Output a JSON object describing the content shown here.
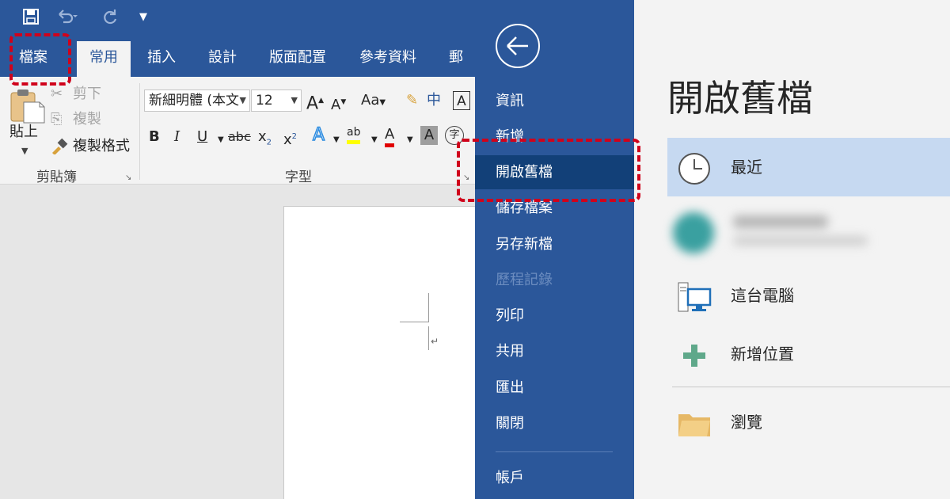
{
  "quick_access": {
    "save_icon": "save-icon",
    "undo_icon": "undo-icon",
    "redo_icon": "redo-icon",
    "customize_icon": "customize-qat-icon"
  },
  "ribbon_tabs": [
    {
      "label": "檔案"
    },
    {
      "label": "常用"
    },
    {
      "label": "插入"
    },
    {
      "label": "設計"
    },
    {
      "label": "版面配置"
    },
    {
      "label": "參考資料"
    },
    {
      "label": "郵件"
    }
  ],
  "clipboard": {
    "paste": "貼上",
    "cut": "剪下",
    "copy": "複製",
    "format_painter": "複製格式",
    "group_label": "剪貼簿"
  },
  "font": {
    "font_name": "新細明體 (本文",
    "font_size": "12",
    "change_case": "Aa",
    "phonetic": "中",
    "bold": "B",
    "italic": "I",
    "underline": "U",
    "strikethrough": "abc",
    "subscript": "x",
    "superscript": "x",
    "text_effects": "A",
    "highlight": "ab",
    "font_color": "A",
    "char_shading": "A",
    "enclose": "字",
    "group_label": "字型"
  },
  "backstage_nav": [
    {
      "label": "資訊",
      "state": "normal"
    },
    {
      "label": "新增",
      "state": "normal"
    },
    {
      "label": "開啟舊檔",
      "state": "selected"
    },
    {
      "label": "儲存檔案",
      "state": "normal"
    },
    {
      "label": "另存新檔",
      "state": "normal"
    },
    {
      "label": "歷程記錄",
      "state": "disabled"
    },
    {
      "label": "列印",
      "state": "normal"
    },
    {
      "label": "共用",
      "state": "normal"
    },
    {
      "label": "匯出",
      "state": "normal"
    },
    {
      "label": "關閉",
      "state": "normal"
    },
    {
      "label": "帳戶",
      "state": "normal"
    }
  ],
  "open_pane": {
    "title": "開啟舊檔",
    "locations": [
      {
        "label": "最近",
        "icon": "clock-icon",
        "selected": true
      },
      {
        "label": "這台電腦",
        "icon": "computer-icon",
        "selected": false
      },
      {
        "label": "新增位置",
        "icon": "plus-icon",
        "selected": false
      },
      {
        "label": "瀏覽",
        "icon": "folder-icon",
        "selected": false
      }
    ]
  },
  "colors": {
    "word_blue": "#2b579a",
    "backstage_selected": "#124078",
    "recent_highlight": "#c6d9f1",
    "annotation_red": "#d0021b",
    "plus_green": "#5fa88a"
  }
}
